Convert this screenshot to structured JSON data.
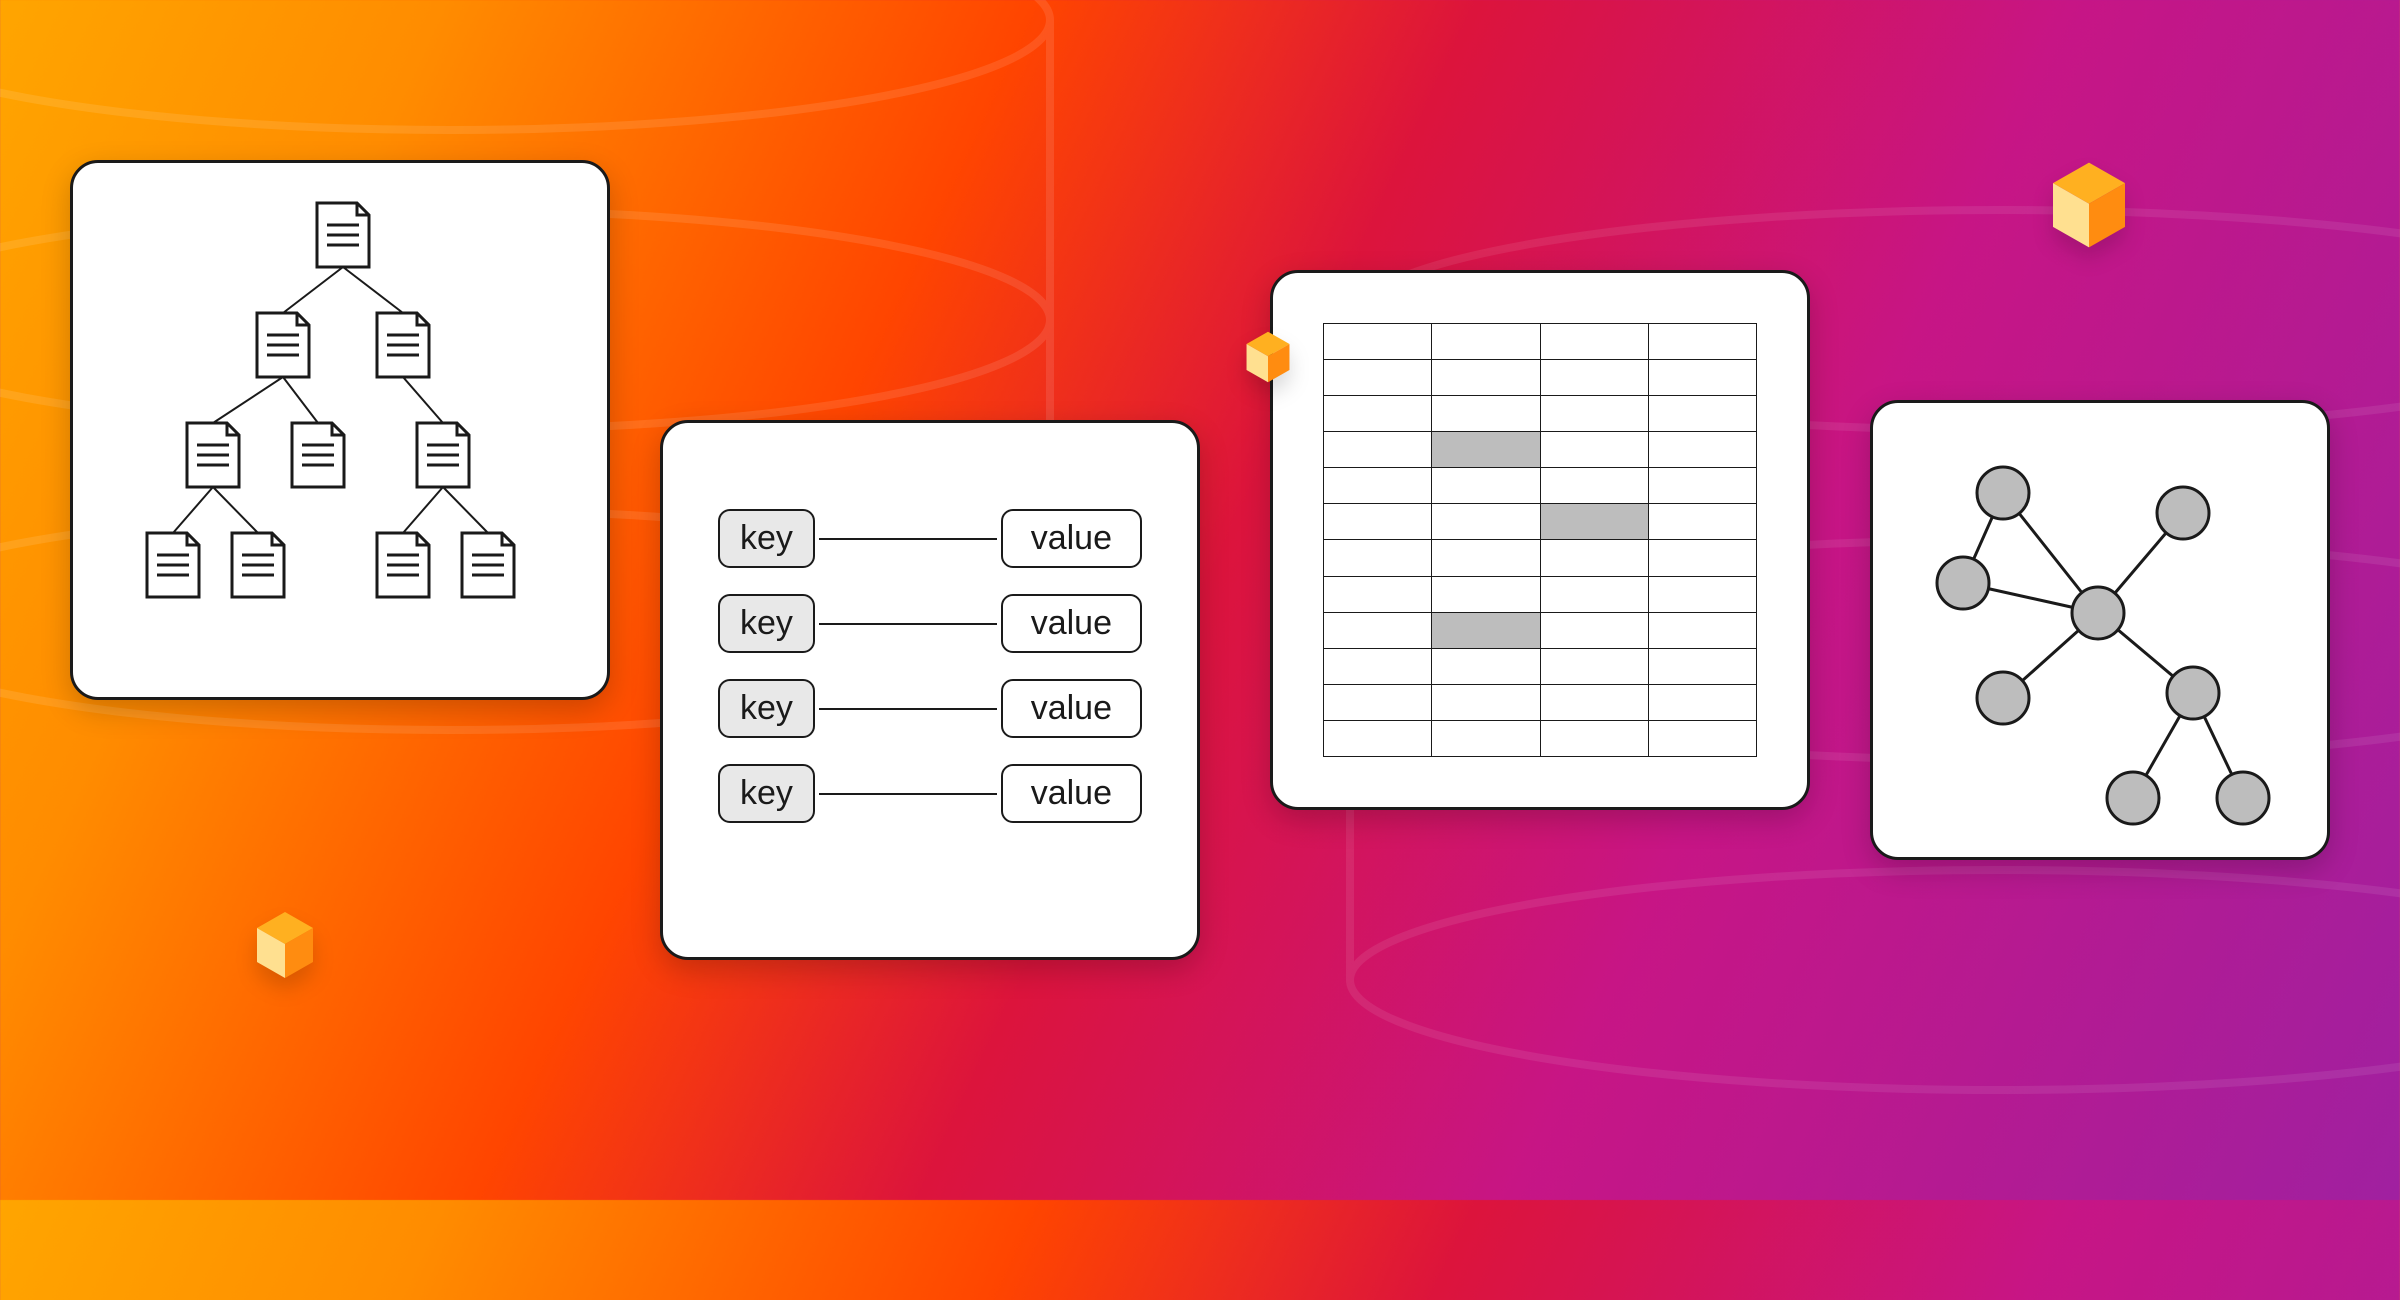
{
  "cards": {
    "document_tree": {
      "icon_name": "document-tree-icon"
    },
    "key_value": {
      "rows": [
        {
          "key": "key",
          "value": "value"
        },
        {
          "key": "key",
          "value": "value"
        },
        {
          "key": "key",
          "value": "value"
        },
        {
          "key": "key",
          "value": "value"
        }
      ]
    },
    "columnar": {
      "cols": 4,
      "rows": 12,
      "filled_cells": [
        {
          "row": 3,
          "col": 1
        },
        {
          "row": 5,
          "col": 2
        },
        {
          "row": 8,
          "col": 1
        }
      ]
    },
    "graph": {
      "icon_name": "graph-network-icon"
    }
  },
  "decorations": {
    "cube_icon": "cube-icon"
  }
}
